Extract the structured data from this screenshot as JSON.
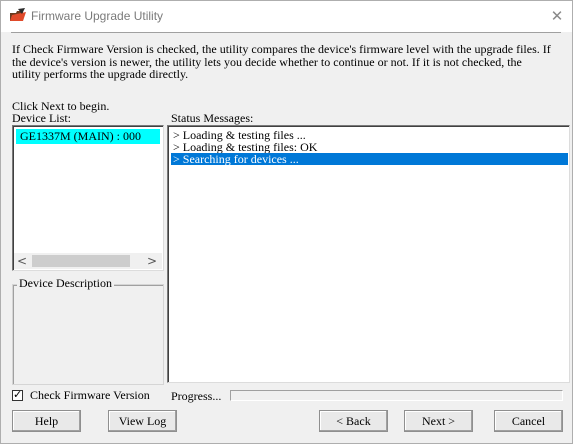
{
  "window": {
    "title": "Firmware Upgrade Utility",
    "close_glyph": "✕",
    "app_icon": "firmware-folder-icon"
  },
  "info": {
    "text": "If Check Firmware Version is checked, the utility compares the device's firmware level with the upgrade files. If the device's version is newer, the utility lets you decide whether to continue or not. If it is not checked, the utility performs the upgrade directly.",
    "click_next": "Click Next to begin."
  },
  "device_list": {
    "label": "Device List:",
    "items": [
      "GE1337M (MAIN) : 000"
    ],
    "scroll_left": "<",
    "scroll_right": ">"
  },
  "device_description": {
    "label": "Device Description"
  },
  "status": {
    "label": "Status Messages:",
    "lines": [
      "> Loading & testing files ...",
      "> Loading & testing files: OK",
      "> Searching for devices ..."
    ],
    "selected_index": 2
  },
  "options": {
    "check_firmware_label": "Check Firmware Version",
    "check_firmware_checked": true,
    "check_mark": "✓",
    "progress_label": "Progress...",
    "progress_value": 0
  },
  "buttons": {
    "help": "Help",
    "view_log": "View Log",
    "back": "< Back",
    "next": "Next >",
    "cancel": "Cancel"
  }
}
